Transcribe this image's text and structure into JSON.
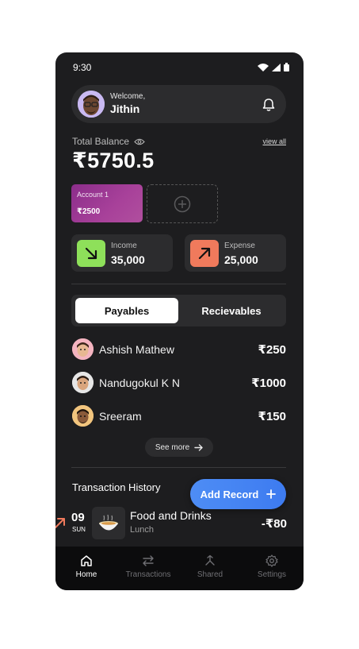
{
  "status_bar": {
    "time": "9:30"
  },
  "header": {
    "welcome": "Welcome,",
    "name": "Jithin"
  },
  "balance": {
    "label": "Total Balance",
    "view_all": "view all",
    "amount": "₹5750.5"
  },
  "accounts": [
    {
      "name": "Account 1",
      "amount": "₹2500",
      "color": "#9b3794"
    }
  ],
  "stats": {
    "income": {
      "label": "Income",
      "value": "35,000",
      "color": "#8ee05a"
    },
    "expense": {
      "label": "Expense",
      "value": "25,000",
      "color": "#f07a5c"
    }
  },
  "tabs": {
    "payables": "Payables",
    "recievables": "Recievables",
    "active": "payables"
  },
  "payables": [
    {
      "name": "Ashish Mathew",
      "amount": "₹250"
    },
    {
      "name": "Nandugokul K N",
      "amount": "₹1000"
    },
    {
      "name": "Sreeram",
      "amount": "₹150"
    }
  ],
  "see_more": "See more",
  "transactions": {
    "title": "Transaction History",
    "add_record": "Add Record",
    "items": [
      {
        "day": "09",
        "dow": "SUN",
        "name": "Food and Drinks",
        "category": "Lunch",
        "amount": "-₹80"
      }
    ]
  },
  "nav": [
    {
      "label": "Home",
      "active": true
    },
    {
      "label": "Transactions",
      "active": false
    },
    {
      "label": "Shared",
      "active": false
    },
    {
      "label": "Settings",
      "active": false
    }
  ]
}
